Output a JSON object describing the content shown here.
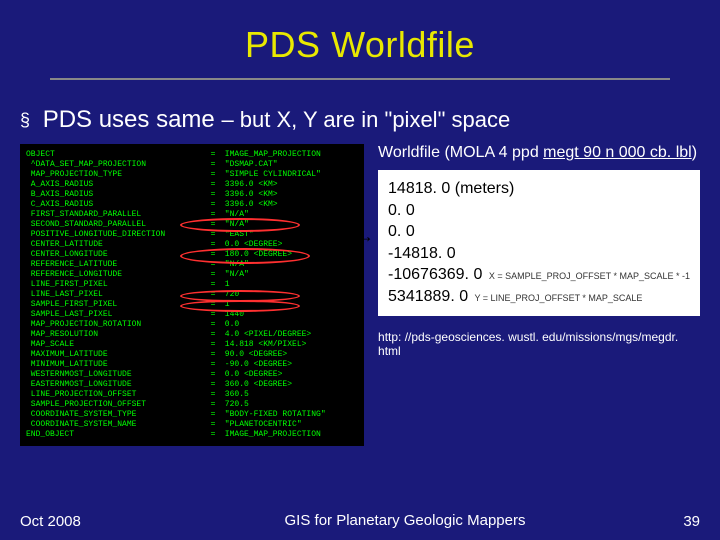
{
  "title": "PDS Worldfile",
  "bullet": {
    "marker": "§",
    "main": "PDS uses same",
    "note": "– but X, Y are in \"pixel\" space"
  },
  "code": {
    "rows": [
      {
        "k": "OBJECT",
        "v": "IMAGE_MAP_PROJECTION"
      },
      {
        "k": " ^DATA_SET_MAP_PROJECTION",
        "v": "\"DSMAP.CAT\""
      },
      {
        "k": " MAP_PROJECTION_TYPE",
        "v": "\"SIMPLE CYLINDRICAL\""
      },
      {
        "k": " A_AXIS_RADIUS",
        "v": "3396.0 <KM>"
      },
      {
        "k": " B_AXIS_RADIUS",
        "v": "3396.0 <KM>"
      },
      {
        "k": " C_AXIS_RADIUS",
        "v": "3396.0 <KM>"
      },
      {
        "k": " FIRST_STANDARD_PARALLEL",
        "v": "\"N/A\""
      },
      {
        "k": " SECOND_STANDARD_PARALLEL",
        "v": "\"N/A\""
      },
      {
        "k": " POSITIVE_LONGITUDE_DIRECTION",
        "v": "\"EAST\""
      },
      {
        "k": " CENTER_LATITUDE",
        "v": "0.0 <DEGREE>"
      },
      {
        "k": " CENTER_LONGITUDE",
        "v": "180.0 <DEGREE>"
      },
      {
        "k": " REFERENCE_LATITUDE",
        "v": "\"N/A\""
      },
      {
        "k": " REFERENCE_LONGITUDE",
        "v": "\"N/A\""
      },
      {
        "k": " LINE_FIRST_PIXEL",
        "v": "1"
      },
      {
        "k": " LINE_LAST_PIXEL",
        "v": "720"
      },
      {
        "k": " SAMPLE_FIRST_PIXEL",
        "v": "1"
      },
      {
        "k": " SAMPLE_LAST_PIXEL",
        "v": "1440"
      },
      {
        "k": " MAP_PROJECTION_ROTATION",
        "v": "0.0"
      },
      {
        "k": " MAP_RESOLUTION",
        "v": "4.0 <PIXEL/DEGREE>"
      },
      {
        "k": " MAP_SCALE",
        "v": "14.818 <KM/PIXEL>"
      },
      {
        "k": " MAXIMUM_LATITUDE",
        "v": "90.0 <DEGREE>"
      },
      {
        "k": " MINIMUM_LATITUDE",
        "v": "-90.0 <DEGREE>"
      },
      {
        "k": " WESTERNMOST_LONGITUDE",
        "v": "0.0 <DEGREE>"
      },
      {
        "k": " EASTERNMOST_LONGITUDE",
        "v": "360.0 <DEGREE>"
      },
      {
        "k": " LINE_PROJECTION_OFFSET",
        "v": "360.5"
      },
      {
        "k": " SAMPLE_PROJECTION_OFFSET",
        "v": "720.5"
      },
      {
        "k": " COORDINATE_SYSTEM_TYPE",
        "v": "\"BODY-FIXED ROTATING\""
      },
      {
        "k": " COORDINATE_SYSTEM_NAME",
        "v": "\"PLANETOCENTRIC\""
      },
      {
        "k": "END_OBJECT",
        "v": "IMAGE_MAP_PROJECTION"
      }
    ]
  },
  "right": {
    "title_prefix": "Worldfile",
    "title_paren": "(MOLA 4 ppd ",
    "title_file": "megt 90 n 000 cb. lbl",
    "title_close": ")"
  },
  "worldfile": {
    "lines": [
      {
        "v": "14818. 0 (meters)",
        "note": ""
      },
      {
        "v": "0. 0",
        "note": ""
      },
      {
        "v": "0. 0",
        "note": ""
      },
      {
        "v": "-14818. 0",
        "note": ""
      },
      {
        "v": "-10676369. 0",
        "note": "X = SAMPLE_PROJ_OFFSET * MAP_SCALE * -1"
      },
      {
        "v": "5341889. 0",
        "note": "Y = LINE_PROJ_OFFSET * MAP_SCALE"
      }
    ]
  },
  "link": "http: //pds-geosciences. wustl. edu/missions/mgs/megdr. html",
  "footer": {
    "date": "Oct 2008",
    "title": "GIS for Planetary Geologic Mappers",
    "page": "39"
  }
}
